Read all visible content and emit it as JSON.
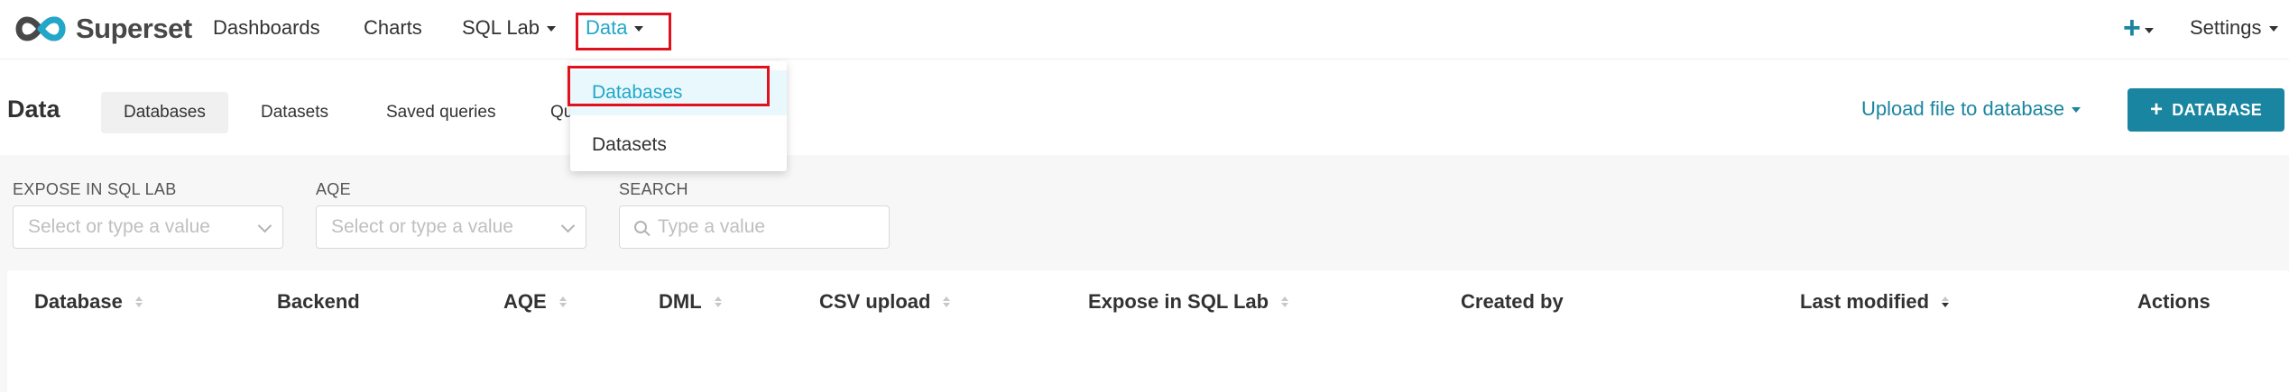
{
  "brand": {
    "name": "Superset"
  },
  "nav": {
    "items": [
      {
        "label": "Dashboards"
      },
      {
        "label": "Charts"
      },
      {
        "label": "SQL Lab"
      },
      {
        "label": "Data"
      }
    ],
    "settings_label": "Settings",
    "new_icon": "plus-icon"
  },
  "data_menu": {
    "items": [
      {
        "label": "Databases",
        "active": true
      },
      {
        "label": "Datasets",
        "active": false
      }
    ]
  },
  "subheader": {
    "title": "Data",
    "tabs": [
      {
        "label": "Databases",
        "active": true
      },
      {
        "label": "Datasets",
        "active": false
      },
      {
        "label": "Saved queries",
        "active": false
      },
      {
        "label": "Qu",
        "active": false
      }
    ],
    "upload_label": "Upload file to database",
    "add_button_label": "DATABASE"
  },
  "filters": [
    {
      "label": "EXPOSE IN SQL LAB",
      "placeholder": "Select or type a value"
    },
    {
      "label": "AQE",
      "placeholder": "Select or type a value"
    },
    {
      "label": "SEARCH",
      "placeholder": "Type a value"
    }
  ],
  "table": {
    "columns": [
      {
        "label": "Database",
        "sortable": true
      },
      {
        "label": "Backend",
        "sortable": false
      },
      {
        "label": "AQE",
        "sortable": true
      },
      {
        "label": "DML",
        "sortable": true
      },
      {
        "label": "CSV upload",
        "sortable": true
      },
      {
        "label": "Expose in SQL Lab",
        "sortable": true
      },
      {
        "label": "Created by",
        "sortable": false
      },
      {
        "label": "Last modified",
        "sortable": true,
        "sorted": "desc"
      },
      {
        "label": "Actions",
        "sortable": false
      }
    ]
  },
  "colors": {
    "accent": "#20a7c9",
    "primary_button": "#1a85a0",
    "highlight": "#e0101d"
  }
}
